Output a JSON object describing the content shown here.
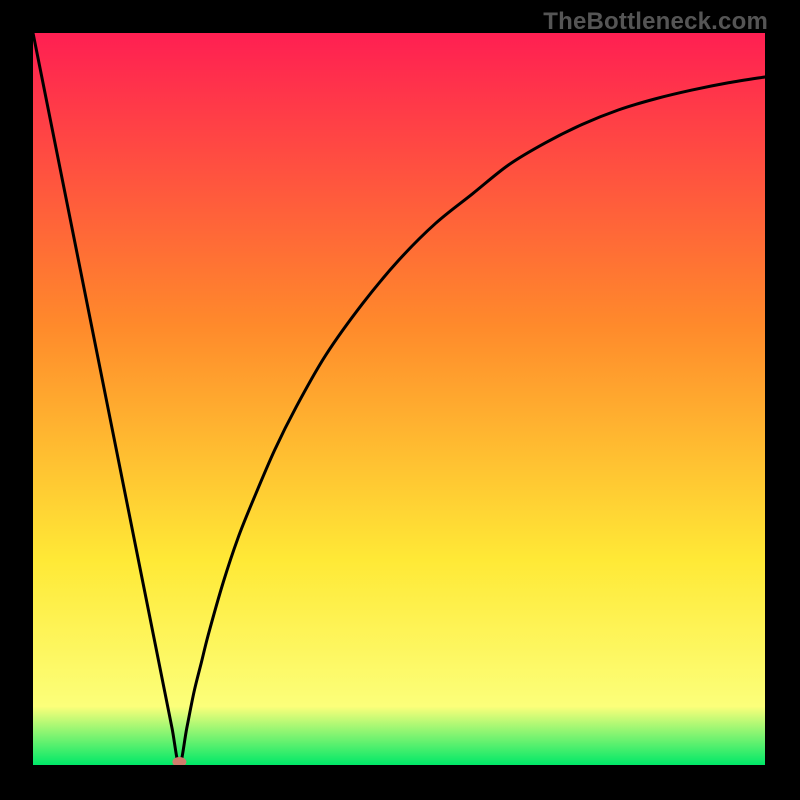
{
  "watermark": "TheBottleneck.com",
  "colors": {
    "bg_frame": "#000000",
    "grad_top": "#ff1f52",
    "grad_mid1": "#ff8a2b",
    "grad_mid2": "#ffe936",
    "grad_low": "#fcff7a",
    "grad_bottom": "#00e868",
    "curve": "#000000",
    "marker": "#cf7d6c"
  },
  "chart_data": {
    "type": "line",
    "title": "",
    "xlabel": "",
    "ylabel": "",
    "x_range": [
      0,
      100
    ],
    "y_range": [
      0,
      100
    ],
    "marker": {
      "x": 20,
      "y": 0
    },
    "series": [
      {
        "name": "bottleneck-curve",
        "x": [
          0,
          2,
          4,
          6,
          8,
          10,
          12,
          14,
          16,
          18,
          19,
          20,
          21,
          22,
          23,
          24,
          26,
          28,
          30,
          33,
          36,
          40,
          45,
          50,
          55,
          60,
          65,
          70,
          75,
          80,
          85,
          90,
          95,
          100
        ],
        "y": [
          100,
          90,
          80,
          70,
          60,
          50,
          40,
          30,
          20,
          10,
          5,
          0,
          5,
          10,
          14,
          18,
          25,
          31,
          36,
          43,
          49,
          56,
          63,
          69,
          74,
          78,
          82,
          85,
          87.5,
          89.5,
          91,
          92.2,
          93.2,
          94
        ]
      }
    ]
  }
}
